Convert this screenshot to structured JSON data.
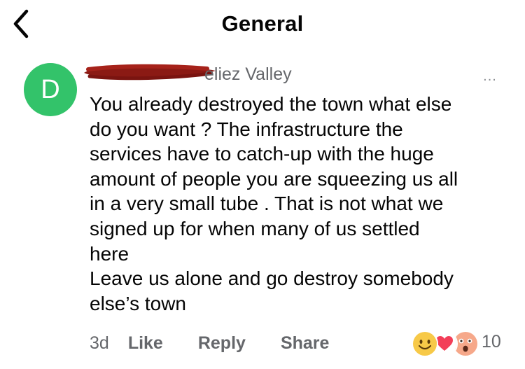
{
  "header": {
    "title": "General"
  },
  "comment": {
    "avatar_initial": "D",
    "author_visible_suffix": "eliez Valley",
    "more_label": "...",
    "body_lines": [
      "You already destroyed the town what else",
      "do you want ? The infrastructure the",
      "services have to catch-up with the huge",
      "amount of people you are squeezing us all",
      "in a very small tube . That is not what we",
      "signed up for when many of us settled",
      "here",
      "Leave us alone and go destroy somebody",
      "else’s town"
    ],
    "time": "3d",
    "like_label": "Like",
    "reply_label": "Reply",
    "share_label": "Share",
    "reaction_icons": [
      "haha-smile-icon",
      "love-heart-icon",
      "wow-face-icon"
    ],
    "reaction_count": "10"
  },
  "colors": {
    "avatar_bg": "#33c36a",
    "secondary_text": "#65676b",
    "redaction": "#8b1a14",
    "love": "#f33e58",
    "haha": "#f7c948"
  }
}
